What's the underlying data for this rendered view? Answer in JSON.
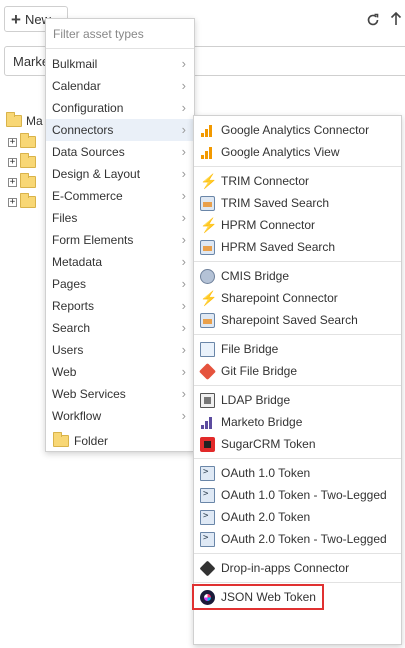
{
  "toolbar": {
    "new_label": "New",
    "refresh_icon": "refresh-icon",
    "up_icon": "up-arrow-icon"
  },
  "search": {
    "value": "Marke"
  },
  "tree": {
    "root_label": "Ma"
  },
  "menu": {
    "filter_placeholder": "Filter asset types",
    "items": [
      {
        "label": "Bulkmail"
      },
      {
        "label": "Calendar"
      },
      {
        "label": "Configuration"
      },
      {
        "label": "Connectors"
      },
      {
        "label": "Data Sources"
      },
      {
        "label": "Design & Layout"
      },
      {
        "label": "E-Commerce"
      },
      {
        "label": "Files"
      },
      {
        "label": "Form Elements"
      },
      {
        "label": "Metadata"
      },
      {
        "label": "Pages"
      },
      {
        "label": "Reports"
      },
      {
        "label": "Search"
      },
      {
        "label": "Users"
      },
      {
        "label": "Web"
      },
      {
        "label": "Web Services"
      },
      {
        "label": "Workflow"
      }
    ],
    "folder_label": "Folder"
  },
  "submenu": {
    "groups": [
      [
        {
          "label": "Google Analytics Connector",
          "icon": "google-analytics-icon"
        },
        {
          "label": "Google Analytics View",
          "icon": "google-analytics-icon"
        }
      ],
      [
        {
          "label": "TRIM Connector",
          "icon": "bolt-icon"
        },
        {
          "label": "TRIM Saved Search",
          "icon": "saved-search-icon"
        },
        {
          "label": "HPRM Connector",
          "icon": "bolt-icon"
        },
        {
          "label": "HPRM Saved Search",
          "icon": "saved-search-icon"
        }
      ],
      [
        {
          "label": "CMIS Bridge",
          "icon": "cmis-icon"
        },
        {
          "label": "Sharepoint Connector",
          "icon": "bolt-blue-icon"
        },
        {
          "label": "Sharepoint Saved Search",
          "icon": "saved-search-icon"
        }
      ],
      [
        {
          "label": "File Bridge",
          "icon": "file-bridge-icon"
        },
        {
          "label": "Git File Bridge",
          "icon": "git-icon"
        }
      ],
      [
        {
          "label": "LDAP Bridge",
          "icon": "ldap-icon"
        },
        {
          "label": "Marketo Bridge",
          "icon": "marketo-icon"
        },
        {
          "label": "SugarCRM Token",
          "icon": "sugarcrm-icon"
        }
      ],
      [
        {
          "label": "OAuth 1.0 Token",
          "icon": "oauth-icon"
        },
        {
          "label": "OAuth 1.0 Token - Two-Legged",
          "icon": "oauth-icon"
        },
        {
          "label": "OAuth 2.0 Token",
          "icon": "oauth-icon"
        },
        {
          "label": "OAuth 2.0 Token - Two-Legged",
          "icon": "oauth-icon"
        }
      ],
      [
        {
          "label": "Drop-in-apps Connector",
          "icon": "dropin-icon"
        }
      ],
      [
        {
          "label": "JSON Web Token",
          "icon": "jwt-icon"
        }
      ]
    ]
  },
  "colors": {
    "highlight": "#e03131",
    "active_row": "#eaf0f8",
    "folder": "#f8d775"
  }
}
